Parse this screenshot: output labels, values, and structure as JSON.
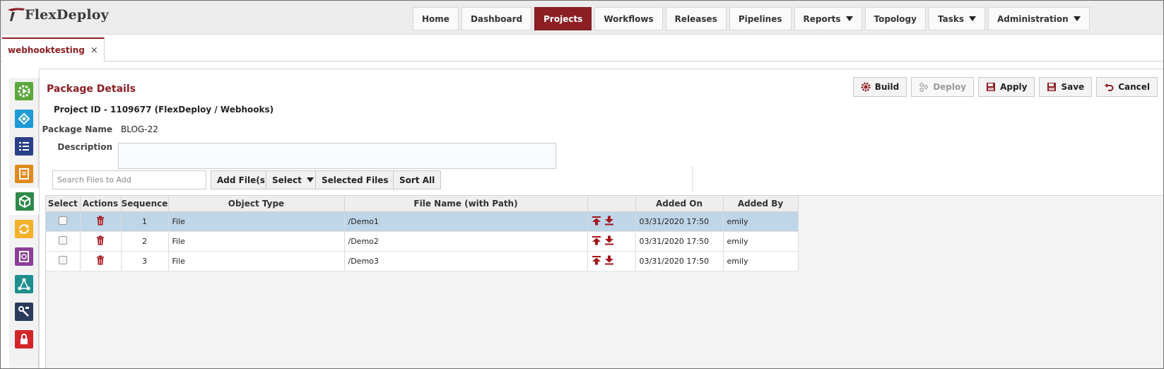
{
  "app": {
    "brand": "FlexDeploy",
    "brand_color": "#8b1f24"
  },
  "nav": {
    "items": [
      {
        "label": "Home"
      },
      {
        "label": "Dashboard"
      },
      {
        "label": "Projects",
        "active": true
      },
      {
        "label": "Workflows"
      },
      {
        "label": "Releases"
      },
      {
        "label": "Pipelines"
      },
      {
        "label": "Reports",
        "dropdown": true
      },
      {
        "label": "Topology"
      },
      {
        "label": "Tasks",
        "dropdown": true
      },
      {
        "label": "Administration",
        "dropdown": true
      }
    ]
  },
  "tabs": [
    {
      "label": "webhooktesting",
      "close": "×"
    }
  ],
  "sidebar": {
    "items": [
      {
        "icon": "gear-play-icon",
        "color": "#5aa83c"
      },
      {
        "icon": "workflow-icon",
        "color": "#1e9bd7"
      },
      {
        "icon": "list-icon",
        "color": "#2b3f87"
      },
      {
        "icon": "document-icon",
        "color": "#e08a1e"
      },
      {
        "icon": "package-icon",
        "color": "#2f8a4a"
      },
      {
        "icon": "sync-icon",
        "color": "#f3b12a"
      },
      {
        "icon": "report-icon",
        "color": "#8a3f98"
      },
      {
        "icon": "topology-icon",
        "color": "#1e8f8f"
      },
      {
        "icon": "tools-icon",
        "color": "#2a3a5a"
      },
      {
        "icon": "lock-icon",
        "color": "#d4262a"
      }
    ]
  },
  "panel": {
    "title": "Package Details",
    "project_id": "Project ID - 1109677 (FlexDeploy / Webhooks)",
    "package_name_label": "Package Name",
    "package_name_value": "BLOG-22",
    "description_label": "Description",
    "description_value": ""
  },
  "actions": {
    "build": "Build",
    "deploy": "Deploy",
    "apply": "Apply",
    "save": "Save",
    "cancel": "Cancel"
  },
  "toolbar": {
    "search_placeholder": "Search Files to Add",
    "add_files": "Add File(s)",
    "select": "Select",
    "selected_files": "Selected Files",
    "sort_all": "Sort All"
  },
  "table": {
    "columns": [
      "Select",
      "Actions",
      "Sequence",
      "Object Type",
      "File Name (with Path)",
      "",
      "Added On",
      "Added By"
    ],
    "rows": [
      {
        "sequence": "1",
        "object_type": "File",
        "file_name": "/Demo1",
        "added_on": "03/31/2020 17:50",
        "added_by": "emily",
        "selected": true
      },
      {
        "sequence": "2",
        "object_type": "File",
        "file_name": "/Demo2",
        "added_on": "03/31/2020 17:50",
        "added_by": "emily",
        "selected": false
      },
      {
        "sequence": "3",
        "object_type": "File",
        "file_name": "/Demo3",
        "added_on": "03/31/2020 17:50",
        "added_by": "emily",
        "selected": false
      }
    ]
  }
}
